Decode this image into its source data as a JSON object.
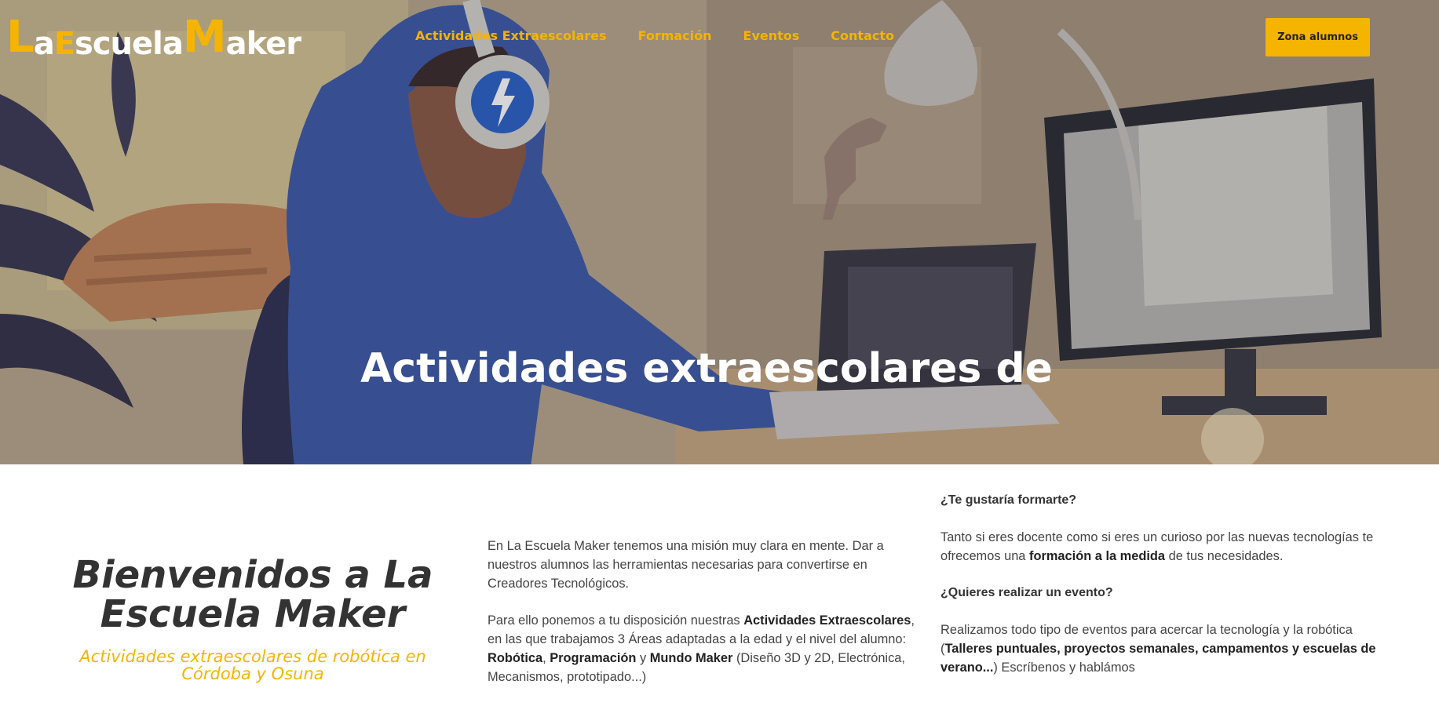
{
  "logo": {
    "parts": [
      {
        "text": "L",
        "size": "big",
        "color": "yellow"
      },
      {
        "text": "a",
        "size": "small",
        "color": "white"
      },
      {
        "text": "E",
        "size": "small",
        "color": "yellow"
      },
      {
        "text": "scuela",
        "size": "small",
        "color": "white"
      },
      {
        "text": "M",
        "size": "big",
        "color": "yellow"
      },
      {
        "text": "aker",
        "size": "small",
        "color": "white"
      }
    ]
  },
  "nav": {
    "items": [
      {
        "label": "Actividades Extraescolares"
      },
      {
        "label": "Formación"
      },
      {
        "label": "Eventos"
      },
      {
        "label": "Contacto"
      }
    ],
    "cta_label": "Zona alumnos"
  },
  "hero": {
    "title": "Actividades extraescolares de"
  },
  "welcome": {
    "title": "Bienvenidos a La Escuela Maker",
    "tagline": "Actividades extraescolares de robótica en Córdoba y Osuna"
  },
  "mission": {
    "p1": "En La Escuela Maker tenemos una misión muy clara en mente. Dar a nuestros alumnos las herramientas necesarias para convertirse en Creadores Tecnológicos.",
    "p2": [
      {
        "t": "Para ello ponemos a tu disposición nuestras ",
        "b": false
      },
      {
        "t": "Actividades Extraescolares",
        "b": true
      },
      {
        "t": ", en las que trabajamos 3 Áreas adaptadas a la edad y el nivel del alumno: ",
        "b": false
      },
      {
        "t": "Robótica",
        "b": true
      },
      {
        "t": ", ",
        "b": false
      },
      {
        "t": "Programación",
        "b": true
      },
      {
        "t": " y ",
        "b": false
      },
      {
        "t": "Mundo Maker",
        "b": true
      },
      {
        "t": " (Diseño 3D y 2D, Electrónica, Mecanismos, prototipado...)",
        "b": false
      }
    ]
  },
  "info": {
    "q1": "¿Te gustaría formarte?",
    "a1": [
      {
        "t": "Tanto si eres docente como si eres un curioso por las nuevas tecnologías te ofrecemos una ",
        "b": false
      },
      {
        "t": "formación a la medida",
        "b": true
      },
      {
        "t": " de tus necesidades.",
        "b": false
      }
    ],
    "q2": "¿Quieres realizar un evento?",
    "a2": [
      {
        "t": "Realizamos todo tipo de eventos para acercar la tecnología y la robótica (",
        "b": false
      },
      {
        "t": "Talleres puntuales, proyectos semanales, campamentos y escuelas de verano...",
        "b": true
      },
      {
        "t": ") Escríbenos y hablámos",
        "b": false
      }
    ]
  },
  "colors": {
    "accent": "#f5b400",
    "text_dark": "#333333",
    "hero_text": "#ffffff"
  },
  "icons": [
    "lightning-icon"
  ]
}
